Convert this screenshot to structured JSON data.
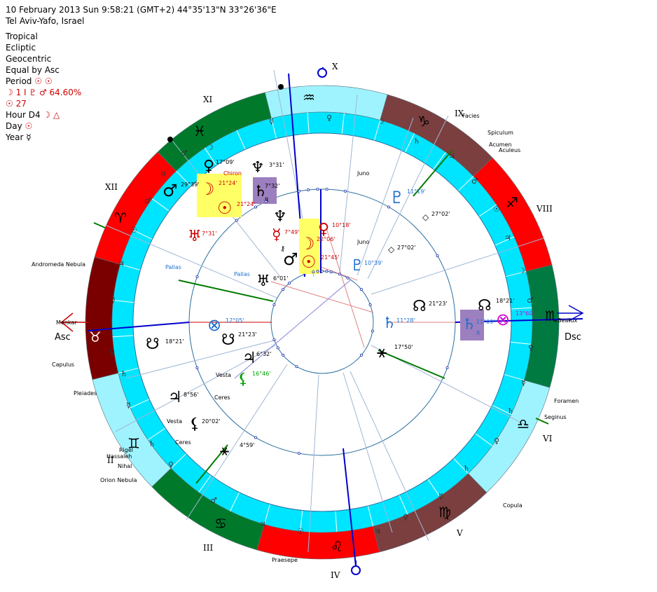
{
  "header": {
    "line1": "10 February 2013   Sun    9:58:21 (GMT+2) 44°35'13\"N  33°26'36\"E",
    "line2": "Tel Aviv-Yafo, Israel"
  },
  "settings": {
    "zodiac": "Tropical",
    "coord": "Ecliptic",
    "center": "Geocentric",
    "houses": "Equal by Asc",
    "period_label": "Period",
    "period_glyphs": "☉ ☉",
    "moon_line": "☽  1 I  ♇ ♂ 64.60%",
    "sun_line": "☉  27",
    "hour_label": "Hour D4",
    "hour_glyphs": "☽ △",
    "day_label": "Day",
    "day_glyph": "☉",
    "year_label": "Year",
    "year_glyph": "☿"
  },
  "houses": {
    "X": "X",
    "XI": "XI",
    "XII": "XII",
    "II": "II",
    "III": "III",
    "IV": "IV",
    "V": "V",
    "VI": "VI",
    "VIII": "VIII",
    "IX": "IX",
    "asc": "Asc",
    "dsc": "Dsc"
  },
  "signs": {
    "aquarius": "♒",
    "capricorn": "♑",
    "sagittarius": "♐",
    "scorpio": "♏",
    "libra": "♎",
    "virgo": "♍",
    "leo": "♌",
    "cancer": "♋",
    "gemini": "♊",
    "taurus": "♉",
    "aries": "♈",
    "pisces": "♓"
  },
  "stars": {
    "facies": "Facies",
    "spiculum": "Spiculum",
    "acumen": "Acumen",
    "aculeus": "Aculeus",
    "juno1": "Juno",
    "juno2": "Juno",
    "andromeda": "Andromeda Nebula",
    "menkar": "Menkar",
    "capulus": "Capulus",
    "pleiades": "Pleiades",
    "rigel": "Rigel",
    "hassaleh": "Hassaleh",
    "nihal": "Nihal",
    "orion": "Orion Nebula",
    "praesepe": "Praesepe",
    "copula": "Copula",
    "seginus": "Seginus",
    "foramen": "Foramen",
    "beatux": "Beatux",
    "pallas1": "Pallas",
    "pallas2": "Pallas",
    "vesta1": "Vesta",
    "vesta2": "Vesta",
    "ceres1": "Ceres",
    "ceres2": "Ceres",
    "chiron": "Chiron"
  },
  "planets_outer": {
    "venus_deg": "17°09'",
    "neptune_deg": "3°31'",
    "mars_deg": "29°39'",
    "moon_deg": "21°24'",
    "sun_deg": "21°24'",
    "saturn_deg": "7°32'",
    "saturn_r": "R",
    "uranus_deg": "7°31'",
    "pluto_deg": "11°19'",
    "point_deg": "27°02'",
    "node_deg": "18°21'",
    "saturn2_deg": "11°09'",
    "saturn2_r": "R",
    "pof_deg": "13°60'",
    "node2_deg": "18°21'",
    "jupiter_deg": "8°56'",
    "lilith_deg": "20°02'",
    "vertex_deg": "4°59'"
  },
  "planets_inner": {
    "mercury_deg": "7°49'",
    "venus_deg": "10°18'",
    "moon_deg": "22°06'",
    "sun_deg": "21°45'",
    "pluto_deg": "10°39'",
    "point_deg": "27°02'",
    "uranus_deg": "6°01'",
    "node_deg": "21°23'",
    "saturn_deg": "11°28'",
    "vertex_deg": "17°50'",
    "pof_deg": "12°05'",
    "node2_deg": "21°23'",
    "jupiter_deg": "6°32'",
    "lilith_deg": "16°46'"
  },
  "colors": {
    "red": "#ff0000",
    "dark_red": "#7a0000",
    "green": "#007a2a",
    "dark_green": "#007a40",
    "brown": "#7b3f3f",
    "cyan": "#00e5ff",
    "light_cyan": "#9ff3ff",
    "blue": "#0000cc",
    "highlight_yellow": "#ffff66",
    "highlight_purple": "#9c7fbf"
  }
}
